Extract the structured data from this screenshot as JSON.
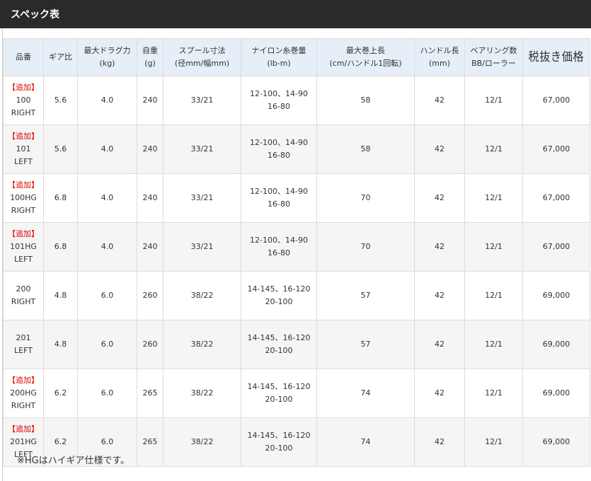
{
  "section_title": "スペック表",
  "headers": {
    "model": "品番",
    "gear": "ギア比",
    "drag_1": "最大ドラグ力",
    "drag_2": "(kg)",
    "weight_1": "自重",
    "weight_2": "(g)",
    "spool_1": "スプール寸法",
    "spool_2": "(径mm/幅mm)",
    "nylon_1": "ナイロン糸巻量",
    "nylon_2": "(lb-m)",
    "retrieve_1": "最大巻上長",
    "retrieve_2": "(cm/ハンドル1回転)",
    "handle_1": "ハンドル長",
    "handle_2": "(mm)",
    "bearing_1": "ベアリング数",
    "bearing_2": "BB/ローラー",
    "price": "税抜き価格"
  },
  "rows": [
    {
      "tag": "【追加】",
      "model_1": "100",
      "model_2": "RIGHT",
      "gear": "5.6",
      "drag": "4.0",
      "weight": "240",
      "spool": "33/21",
      "nylon_1": "12-100、14-90",
      "nylon_2": "16-80",
      "retrieve": "58",
      "handle": "42",
      "bearing": "12/1",
      "price": "67,000"
    },
    {
      "tag": "【追加】",
      "model_1": "101",
      "model_2": "LEFT",
      "gear": "5.6",
      "drag": "4.0",
      "weight": "240",
      "spool": "33/21",
      "nylon_1": "12-100、14-90",
      "nylon_2": "16-80",
      "retrieve": "58",
      "handle": "42",
      "bearing": "12/1",
      "price": "67,000"
    },
    {
      "tag": "【追加】",
      "model_1": "100HG",
      "model_2": "RIGHT",
      "gear": "6.8",
      "drag": "4.0",
      "weight": "240",
      "spool": "33/21",
      "nylon_1": "12-100、14-90",
      "nylon_2": "16-80",
      "retrieve": "70",
      "handle": "42",
      "bearing": "12/1",
      "price": "67,000"
    },
    {
      "tag": "【追加】",
      "model_1": "101HG",
      "model_2": "LEFT",
      "gear": "6.8",
      "drag": "4.0",
      "weight": "240",
      "spool": "33/21",
      "nylon_1": "12-100、14-90",
      "nylon_2": "16-80",
      "retrieve": "70",
      "handle": "42",
      "bearing": "12/1",
      "price": "67,000"
    },
    {
      "tag": "",
      "model_1": "200",
      "model_2": "RIGHT",
      "gear": "4.8",
      "drag": "6.0",
      "weight": "260",
      "spool": "38/22",
      "nylon_1": "14-145、16-120",
      "nylon_2": "20-100",
      "retrieve": "57",
      "handle": "42",
      "bearing": "12/1",
      "price": "69,000"
    },
    {
      "tag": "",
      "model_1": "201",
      "model_2": "LEFT",
      "gear": "4.8",
      "drag": "6.0",
      "weight": "260",
      "spool": "38/22",
      "nylon_1": "14-145、16-120",
      "nylon_2": "20-100",
      "retrieve": "57",
      "handle": "42",
      "bearing": "12/1",
      "price": "69,000"
    },
    {
      "tag": "【追加】",
      "model_1": "200HG",
      "model_2": "RIGHT",
      "gear": "6.2",
      "drag": "6.0",
      "weight": "265",
      "spool": "38/22",
      "nylon_1": "14-145、16-120",
      "nylon_2": "20-100",
      "retrieve": "74",
      "handle": "42",
      "bearing": "12/1",
      "price": "69,000"
    },
    {
      "tag": "【追加】",
      "model_1": "201HG",
      "model_2": "LEFT",
      "gear": "6.2",
      "drag": "6.0",
      "weight": "265",
      "spool": "38/22",
      "nylon_1": "14-145、16-120",
      "nylon_2": "20-100",
      "retrieve": "74",
      "handle": "42",
      "bearing": "12/1",
      "price": "69,000"
    }
  ],
  "note": "※HGはハイギア仕様です。",
  "colors": {
    "title_bar": "#2a2a2a",
    "header_bg": "#e6eef7",
    "added_tag": "#e00000",
    "row_alt": "#f5f5f5"
  }
}
